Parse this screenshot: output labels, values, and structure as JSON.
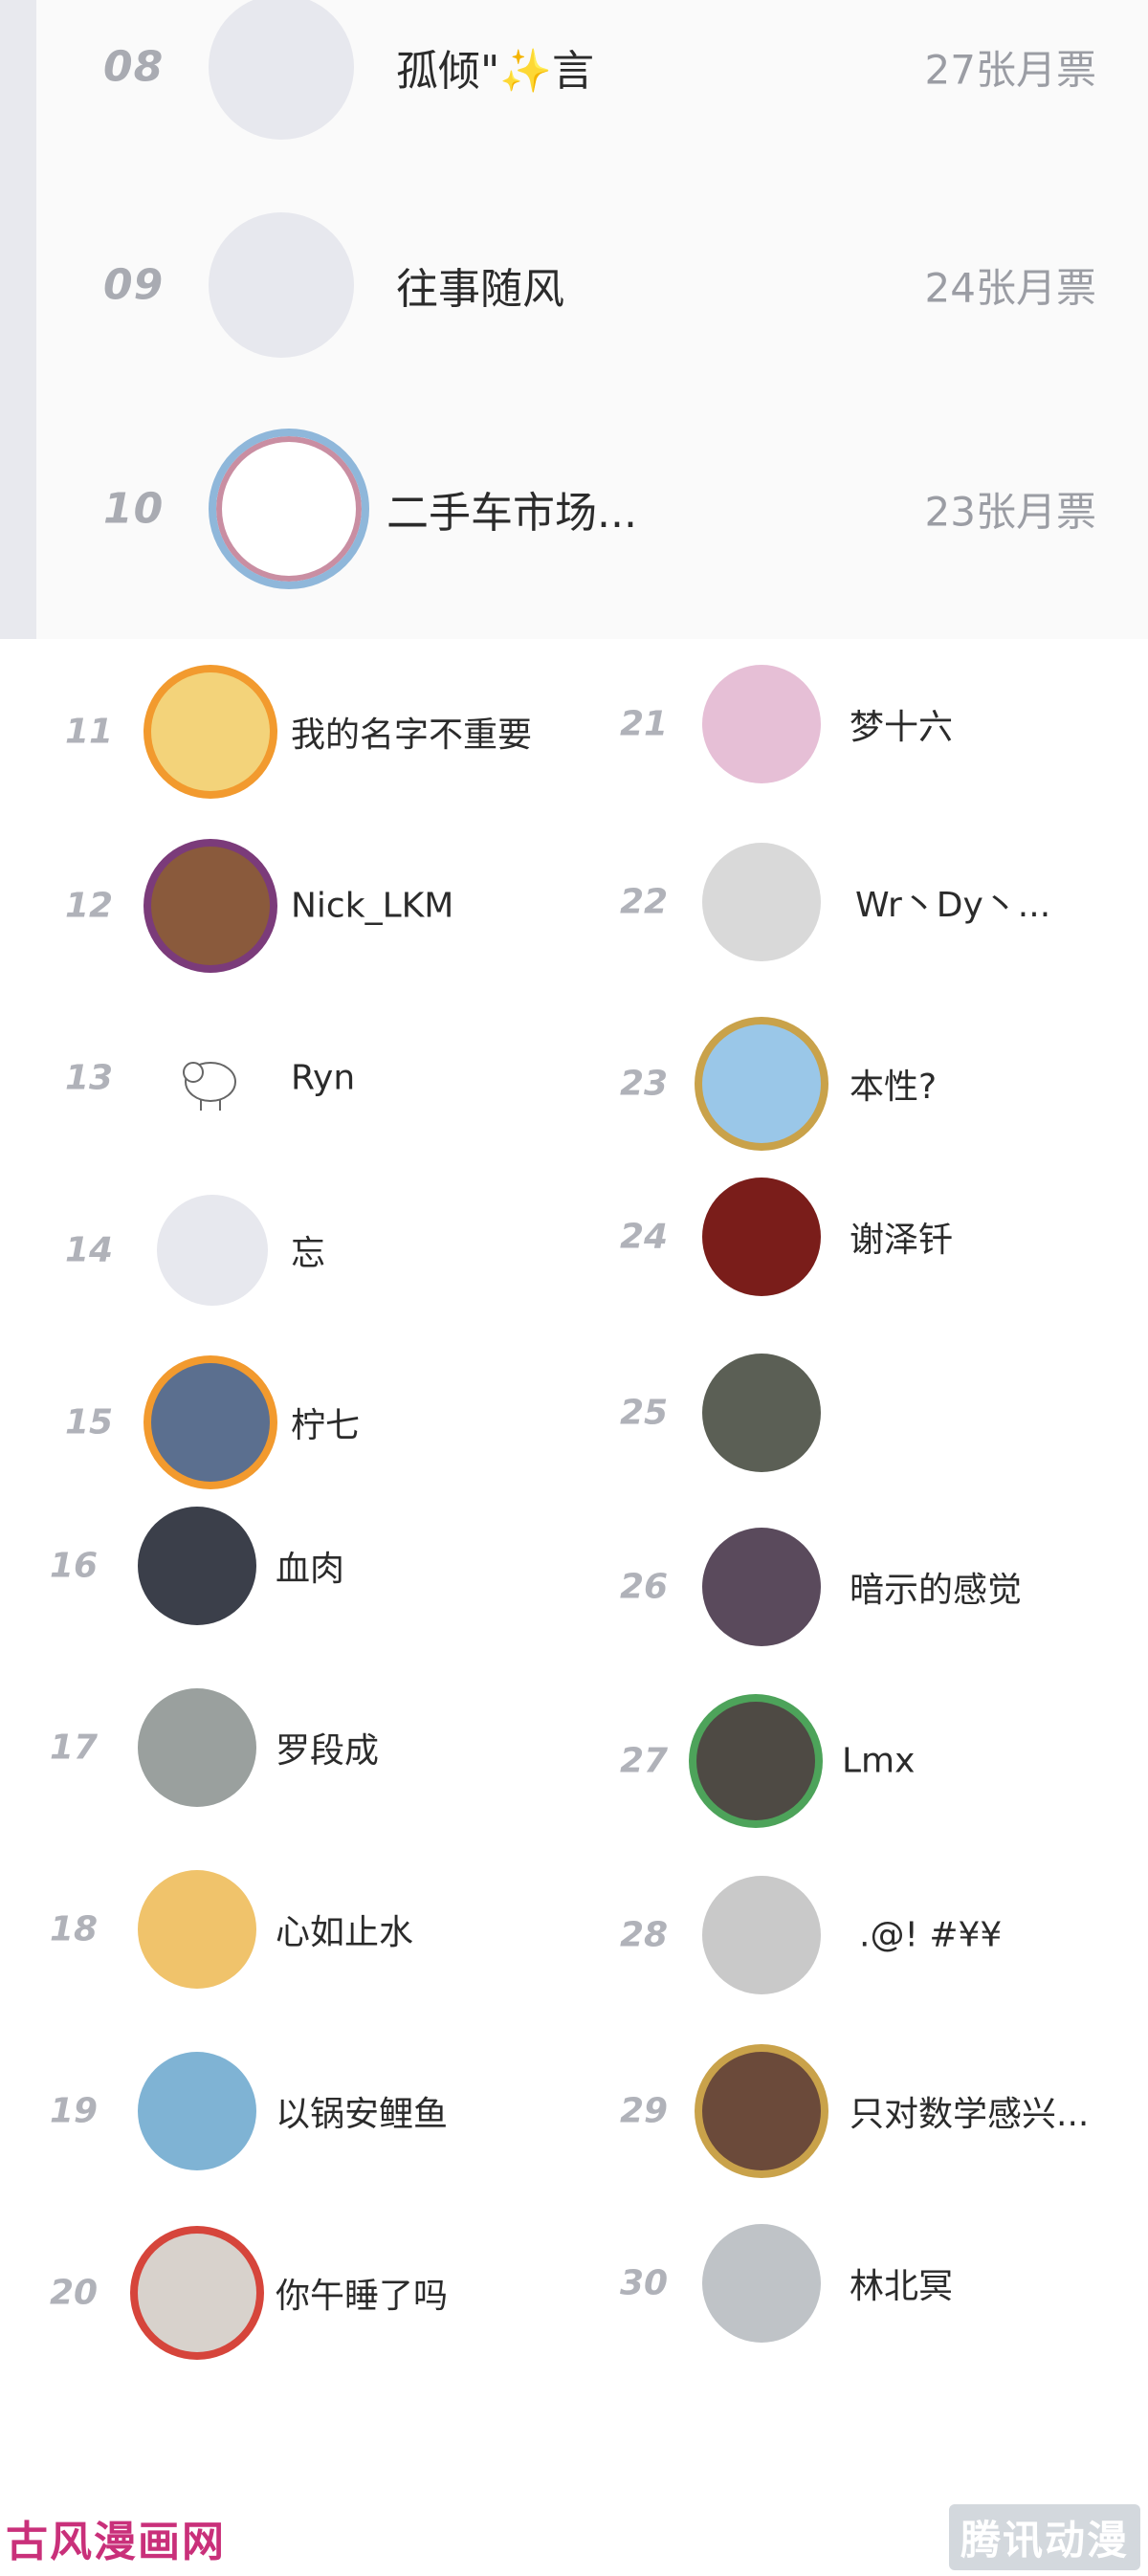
{
  "top_rows": [
    {
      "rank": "08",
      "name": "孤倾\"✨言",
      "votes": "27张月票"
    },
    {
      "rank": "09",
      "name": "往事随风",
      "votes": "24张月票"
    },
    {
      "rank": "10",
      "name": "二手车市场...",
      "votes": "23张月票"
    }
  ],
  "left_column": [
    {
      "rank": "11",
      "name": "我的名字不重要",
      "avatar_color": "#f3d37a"
    },
    {
      "rank": "12",
      "name": "Nick_LKM",
      "avatar_color": "#8a5a3c"
    },
    {
      "rank": "13",
      "name": "Ryn",
      "avatar_color": "#ffffff"
    },
    {
      "rank": "14",
      "name": "忘",
      "avatar_color": "#e7e8ee"
    },
    {
      "rank": "15",
      "name": "柠七",
      "avatar_color": "#5b6f8f"
    },
    {
      "rank": "16",
      "name": "血肉",
      "avatar_color": "#3b3f4a"
    },
    {
      "rank": "17",
      "name": "罗段成",
      "avatar_color": "#9aa09e"
    },
    {
      "rank": "18",
      "name": "心如止水",
      "avatar_color": "#f0c36b"
    },
    {
      "rank": "19",
      "name": "以锅安鲤鱼",
      "avatar_color": "#7fb3d4"
    },
    {
      "rank": "20",
      "name": "你午睡了吗",
      "avatar_color": "#d8d2cc"
    }
  ],
  "right_column": [
    {
      "rank": "21",
      "name": "梦十六",
      "avatar_color": "#e6bfd6"
    },
    {
      "rank": "22",
      "name": "Wr丶Dy丶...",
      "avatar_color": "#d9d9d9"
    },
    {
      "rank": "23",
      "name": "本性?",
      "avatar_color": "#9ac7e8"
    },
    {
      "rank": "24",
      "name": "谢泽钎",
      "avatar_color": "#7a1d1a"
    },
    {
      "rank": "25",
      "name": "",
      "avatar_color": "#5b5f55"
    },
    {
      "rank": "26",
      "name": "暗示的感觉",
      "avatar_color": "#5a4a5c"
    },
    {
      "rank": "27",
      "name": "Lmx",
      "avatar_color": "#4e4a44"
    },
    {
      "rank": "28",
      "name": ".@! #¥¥",
      "avatar_color": "#c9c9c9"
    },
    {
      "rank": "29",
      "name": "只对数学感兴...",
      "avatar_color": "#6b4a3a"
    },
    {
      "rank": "30",
      "name": "林北冥",
      "avatar_color": "#bfc3c7"
    }
  ],
  "watermarks": {
    "left": "古风漫画网",
    "right": "腾讯动漫"
  },
  "icons": {
    "sparkle": "sparkle-icon",
    "sheep": "sheep-icon"
  }
}
